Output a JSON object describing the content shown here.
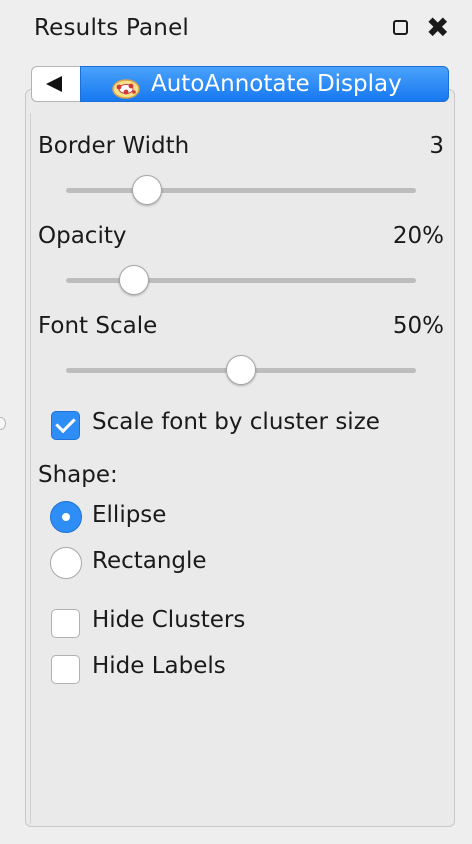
{
  "panel": {
    "title": "Results Panel",
    "float_icon": "float-window-icon",
    "close_icon": "close-icon"
  },
  "header": {
    "back_icon": "back-arrow-icon",
    "title_icon": "autoannotate-logo-icon",
    "title": "AutoAnnotate Display",
    "accent": "#2f8df6"
  },
  "sliders": [
    {
      "label": "Border Width",
      "value_text": "3",
      "position": 0.23
    },
    {
      "label": "Opacity",
      "value_text": "20%",
      "position": 0.195
    },
    {
      "label": "Font Scale",
      "value_text": "50%",
      "position": 0.5
    }
  ],
  "scale_font": {
    "label": "Scale font by cluster size",
    "checked": true
  },
  "shape": {
    "label": "Shape:",
    "options": [
      {
        "label": "Ellipse",
        "selected": true
      },
      {
        "label": "Rectangle",
        "selected": false
      }
    ]
  },
  "hide_clusters": {
    "label": "Hide Clusters",
    "checked": false
  },
  "hide_labels": {
    "label": "Hide Labels",
    "checked": false
  }
}
